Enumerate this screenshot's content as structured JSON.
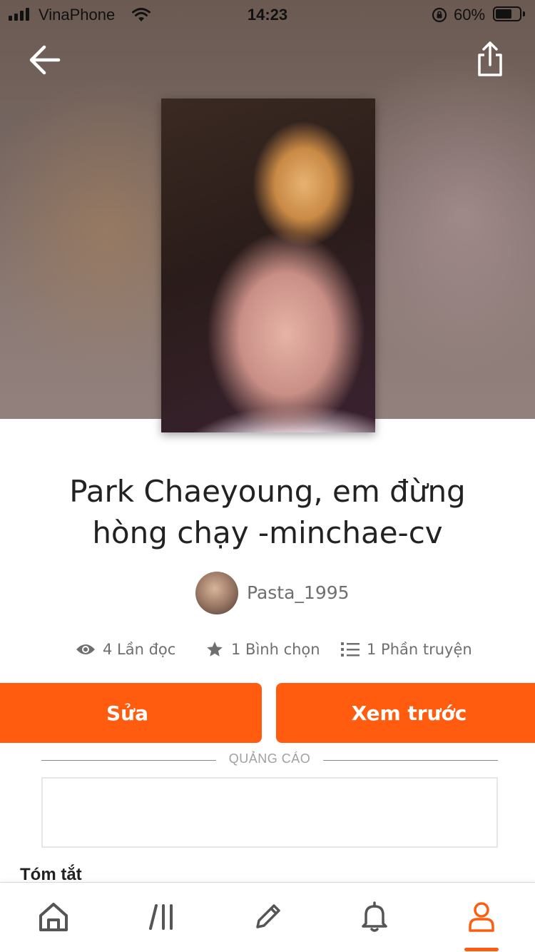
{
  "status_bar": {
    "carrier": "VinaPhone",
    "time": "14:23",
    "battery_percent": "60%",
    "battery_level": 0.6,
    "icons": [
      "signal-icon",
      "wifi-icon",
      "rotation-lock-icon",
      "battery-icon"
    ]
  },
  "header": {
    "back_icon": "arrow-left-icon",
    "share_icon": "share-icon"
  },
  "story": {
    "title": "Park Chaeyoung, em đừng hòng chạy -minchae-cv",
    "author": "Pasta_1995",
    "stats": {
      "reads": "4 Lần đọc",
      "votes": "1 Bình chọn",
      "parts": "1 Phần truyện"
    }
  },
  "actions": {
    "edit_label": "Sửa",
    "preview_label": "Xem trước"
  },
  "ad": {
    "label": "QUẢNG CÁO"
  },
  "summary": {
    "heading": "Tóm tắt"
  },
  "bottom_nav": {
    "items": [
      "home-icon",
      "library-icon",
      "write-icon",
      "notifications-icon",
      "profile-icon"
    ],
    "active": "profile-icon"
  },
  "colors": {
    "accent": "#ff5c0f",
    "text": "#222222",
    "muted": "#6f6f6f"
  }
}
